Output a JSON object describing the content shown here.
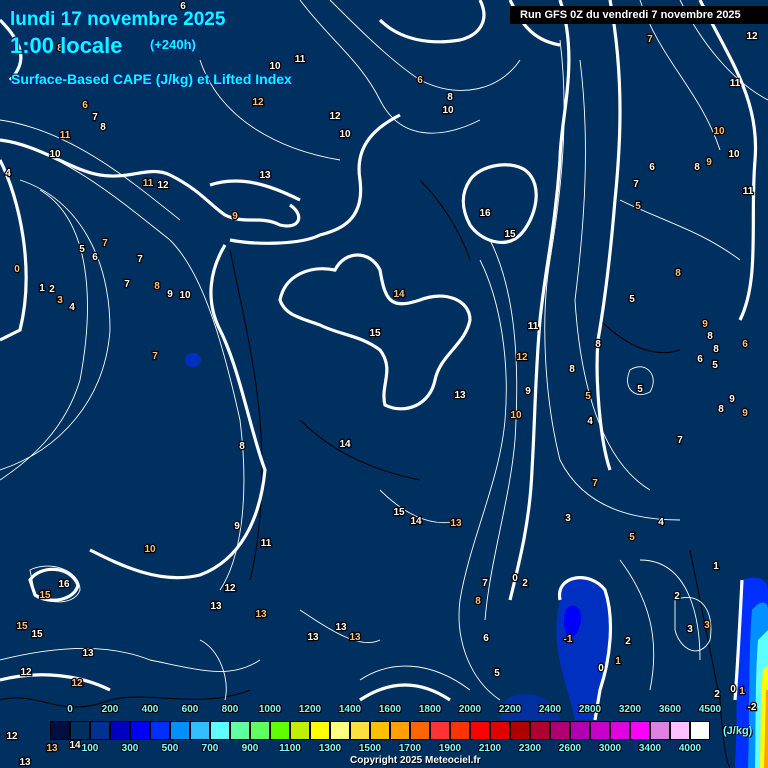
{
  "header": {
    "date": "lundi 17 novembre 2025",
    "time": "1:00 locale",
    "lead": "(+240h)",
    "parameter": "Surface-Based CAPE (J/kg) et Lifted Index",
    "run": "Run GFS 0Z du vendredi 7 novembre 2025"
  },
  "legend": {
    "unit": "(J/kg)",
    "top_labels": [
      "0",
      "200",
      "400",
      "600",
      "800",
      "1000",
      "1200",
      "1400",
      "1600",
      "1800",
      "2000",
      "2200",
      "2400",
      "2800",
      "3200",
      "3600",
      "4500"
    ],
    "bottom_labels": [
      "100",
      "300",
      "500",
      "700",
      "900",
      "1100",
      "1300",
      "1500",
      "1700",
      "1900",
      "2100",
      "2300",
      "2600",
      "3000",
      "3400",
      "4000"
    ],
    "colors": [
      "#000f40",
      "#00305f",
      "#003090",
      "#0000c0",
      "#0000ff",
      "#0030ff",
      "#0090ff",
      "#30c0ff",
      "#60ffff",
      "#60ff9f",
      "#60ff60",
      "#60ff00",
      "#c0f000",
      "#ffff00",
      "#ffff80",
      "#ffe040",
      "#ffc000",
      "#ffa000",
      "#ff6600",
      "#ff3333",
      "#ff3300",
      "#ff0000",
      "#e00000",
      "#b00000",
      "#b00030",
      "#b00070",
      "#b000b0",
      "#c800c8",
      "#e000e0",
      "#ff00ff",
      "#e080e0",
      "#ffc0ff",
      "#ffffff"
    ]
  },
  "map": {
    "lifted_index_labels": [
      "6",
      "8",
      "11",
      "10",
      "6",
      "8",
      "10",
      "7",
      "12",
      "11",
      "12",
      "12",
      "10",
      "6",
      "7",
      "8",
      "11",
      "10",
      "4",
      "11",
      "12",
      "13",
      "9",
      "16",
      "15",
      "10",
      "6",
      "8",
      "9",
      "10",
      "7",
      "5",
      "11",
      "5",
      "7",
      "6",
      "7",
      "0",
      "1",
      "2",
      "3",
      "4",
      "7",
      "8",
      "9",
      "10",
      "14",
      "15",
      "11",
      "12",
      "8",
      "5",
      "9",
      "8",
      "8",
      "6",
      "6",
      "5",
      "8",
      "8",
      "5",
      "5",
      "9",
      "13",
      "10",
      "4",
      "9",
      "9",
      "8",
      "7",
      "7",
      "8",
      "14",
      "7",
      "3",
      "4",
      "5",
      "15",
      "14",
      "13",
      "9",
      "11",
      "10",
      "1",
      "16",
      "15",
      "12",
      "13",
      "13",
      "7",
      "0",
      "8",
      "2",
      "2",
      "15",
      "15",
      "13",
      "13",
      "13",
      "13",
      "-1",
      "2",
      "3",
      "3",
      "6",
      "0",
      "1",
      "12",
      "5",
      "12",
      "2",
      "0",
      "1",
      "-2",
      "12",
      "13",
      "14",
      "13"
    ]
  },
  "footer": {
    "copyright": "Copyright 2025 Meteociel.fr"
  }
}
